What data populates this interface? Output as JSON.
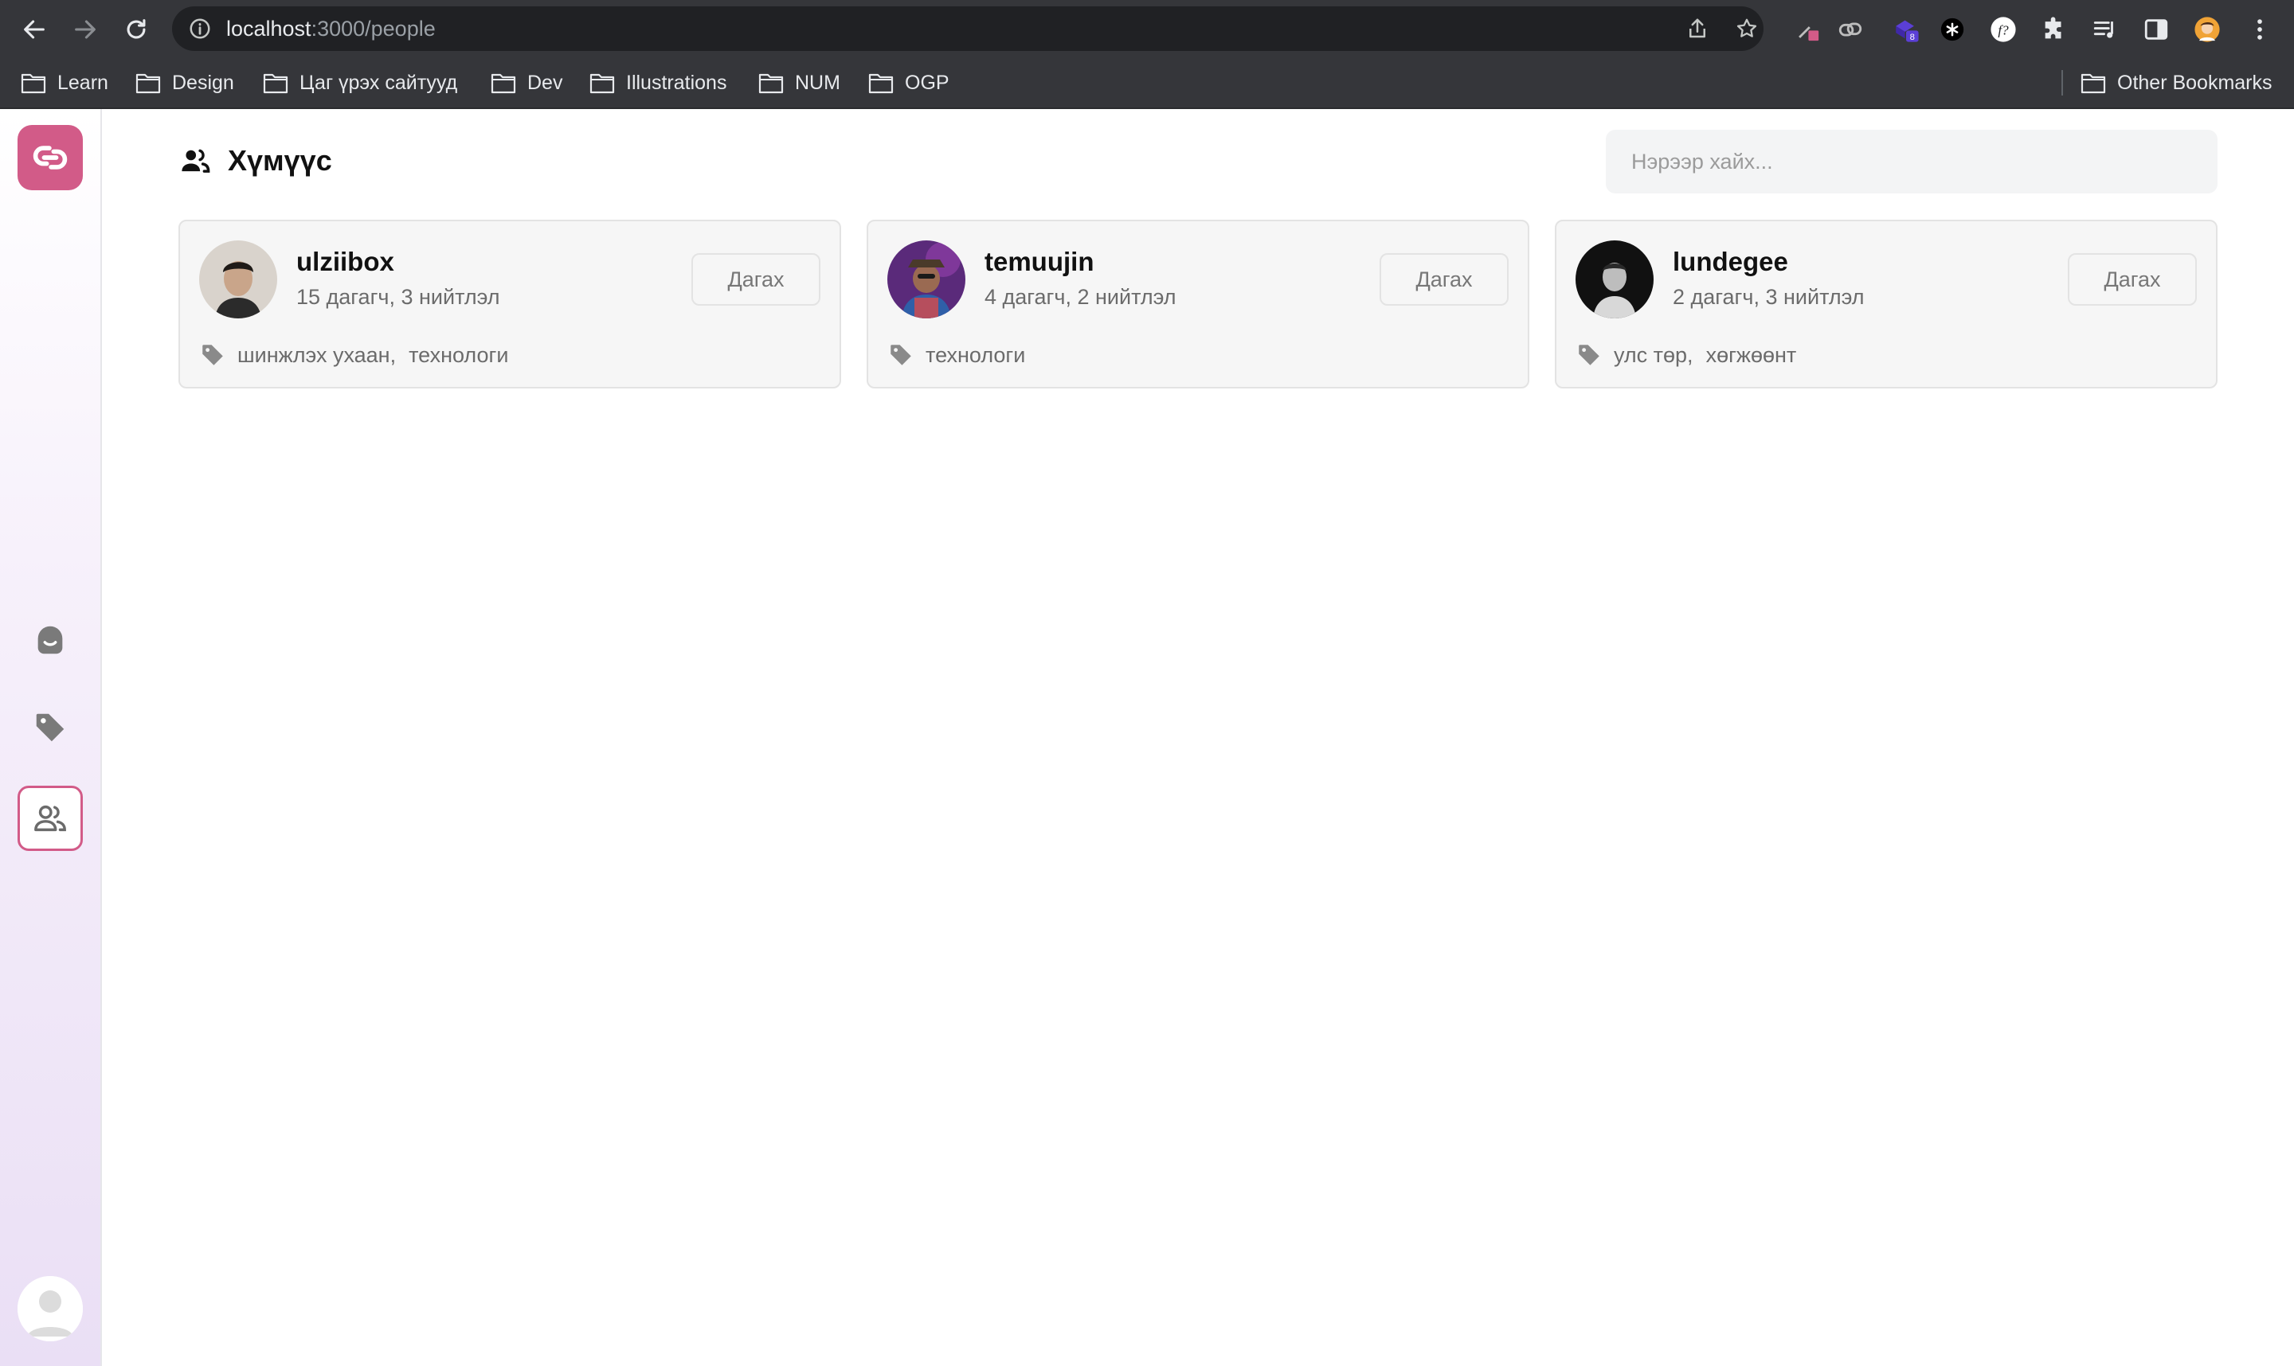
{
  "browser": {
    "url_host": "localhost",
    "url_path": ":3000/people",
    "extension_badge": "8",
    "bookmarks": [
      {
        "label": "Learn"
      },
      {
        "label": "Design"
      },
      {
        "label": "Цаг үрэх сайтууд"
      },
      {
        "label": "Dev"
      },
      {
        "label": "Illustrations"
      },
      {
        "label": "NUM"
      },
      {
        "label": "OGP"
      }
    ],
    "other_bookmarks": "Other Bookmarks"
  },
  "page": {
    "title": "Хүмүүс",
    "search_placeholder": "Нэрээр хайх..."
  },
  "people": [
    {
      "username": "ulziibox",
      "stats": "15 дагагч, 3 нийтлэл",
      "follow_label": "Дагах",
      "tags": [
        "шинжлэх ухаан,",
        "технологи"
      ]
    },
    {
      "username": "temuujin",
      "stats": "4 дагагч, 2 нийтлэл",
      "follow_label": "Дагах",
      "tags": [
        "технологи"
      ]
    },
    {
      "username": "lundegee",
      "stats": "2 дагагч, 3 нийтлэл",
      "follow_label": "Дагах",
      "tags": [
        "улс төр,",
        "хөгжөөнт"
      ]
    }
  ],
  "colors": {
    "brand": "#d25b88",
    "chrome": "#35363a",
    "card_bg": "#f6f6f6"
  }
}
